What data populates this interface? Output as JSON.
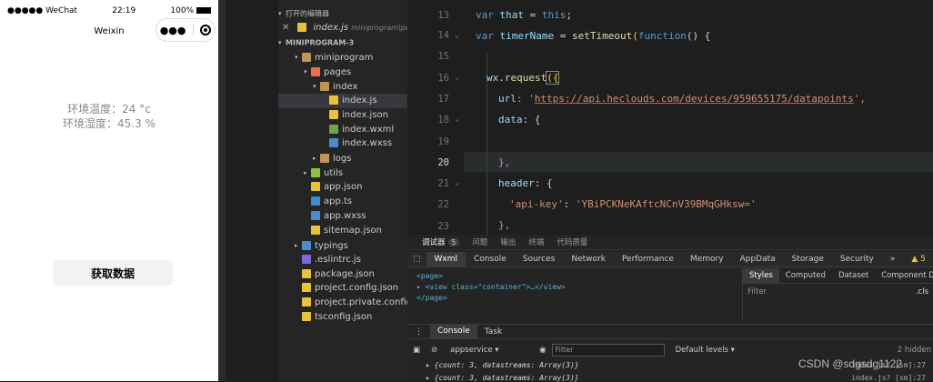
{
  "phone": {
    "status": {
      "carrier": "●●●●● WeChat",
      "time": "22:19",
      "battery": "100%"
    },
    "nav_title": "Weixin",
    "env_temp": "环境温度：24 °c",
    "env_humidity": "环境湿度：45.3 %",
    "button_label": "获取数据"
  },
  "explorer": {
    "open_editors_header": "打开的编辑器",
    "open_file": "index.js",
    "open_file_path": "miniprogram\\pa...",
    "project_header": "MINIPROGRAM-3",
    "tree": [
      {
        "label": "miniprogram",
        "type": "folder",
        "color": "#c09553"
      },
      {
        "label": "pages",
        "type": "folder",
        "color": "#e8704a"
      },
      {
        "label": "index",
        "type": "folder",
        "color": "#c09553"
      },
      {
        "label": "index.js",
        "type": "js",
        "color": "#e8c33a"
      },
      {
        "label": "index.json",
        "type": "json",
        "color": "#e8c33a"
      },
      {
        "label": "index.wxml",
        "type": "wxml",
        "color": "#6aa84f"
      },
      {
        "label": "index.wxss",
        "type": "wxss",
        "color": "#4b8bd0"
      },
      {
        "label": "logs",
        "type": "folder",
        "color": "#c09553"
      },
      {
        "label": "utils",
        "type": "folder",
        "color": "#8bc34a"
      },
      {
        "label": "app.json",
        "type": "json",
        "color": "#e8c33a"
      },
      {
        "label": "app.ts",
        "type": "ts",
        "color": "#3f8ad3"
      },
      {
        "label": "app.wxss",
        "type": "wxss",
        "color": "#4b8bd0"
      },
      {
        "label": "sitemap.json",
        "type": "json",
        "color": "#e8c33a"
      },
      {
        "label": "typings",
        "type": "folder",
        "color": "#4b8bd0"
      },
      {
        "label": ".eslintrc.js",
        "type": "eslint",
        "color": "#7c6bd6"
      },
      {
        "label": "package.json",
        "type": "json",
        "color": "#e8c33a"
      },
      {
        "label": "project.config.json",
        "type": "json",
        "color": "#e8c33a"
      },
      {
        "label": "project.private.config.js...",
        "type": "json",
        "color": "#e8c33a"
      },
      {
        "label": "tsconfig.json",
        "type": "json",
        "color": "#e8c33a"
      }
    ]
  },
  "editor": {
    "line_numbers": [
      "13",
      "14",
      "15",
      "16",
      "17",
      "18",
      "19",
      "20",
      "21",
      "22",
      "23"
    ],
    "current_line": "20",
    "code": {
      "l13a": "var",
      "l13b": "that",
      "l13c": " = ",
      "l13d": "this",
      "l13e": ";",
      "l14a": "var",
      "l14b": "timerName",
      "l14c": " = ",
      "l14d": "setTimeout",
      "l14e": "(",
      "l14f": "function",
      "l14g": "() {",
      "l16a": "wx",
      "l16b": ".",
      "l16c": "request",
      "l16d": "({",
      "l17a": "url",
      "l17b": ": '",
      "l17c": "https://api.heclouds.com/devices/959655175/datapoints",
      "l17d": "',",
      "l18a": "data",
      "l18b": ": {",
      "l20a": "},",
      "l21a": "header",
      "l21b": ": {",
      "l22a": "'api-key'",
      "l22b": ": ",
      "l22c": "'YBiPCKNeKAftcNCnV39BMqGHksw='",
      "l23a": "},"
    }
  },
  "devtools": {
    "top_tabs": {
      "debugger": "调试器",
      "debugger_count": "5",
      "problems": "问题",
      "output": "输出",
      "terminal": "终端",
      "code_quality": "代码质量"
    },
    "tabs": [
      "Wxml",
      "Console",
      "Sources",
      "Network",
      "Performance",
      "Memory",
      "AppData",
      "Storage",
      "Security"
    ],
    "more": "»",
    "warnings": "▲ 5",
    "wxml_lines": {
      "l1": "<page>",
      "l2": "▸ <view class=\"container\">…</view>",
      "l3": "</page>"
    },
    "styles_tabs": [
      "Styles",
      "Computed",
      "Dataset",
      "Component Data"
    ],
    "styles_filter": "Filter",
    "styles_cls": ".cls",
    "console_tabs": [
      "Console",
      "Task"
    ],
    "context": "appservice",
    "filter_placeholder": "Filter",
    "levels": "Default levels ▾",
    "hidden": "2 hidden",
    "log1": "▸ {count: 3, datastreams: Array(3)}",
    "log1_src": "index.js? [sm]:27",
    "log2": "▸ {count: 3, datastreams: Array(3)}",
    "log2_src": "index.js? [sm]:27"
  },
  "watermark": "CSDN @sdgsdg1122"
}
